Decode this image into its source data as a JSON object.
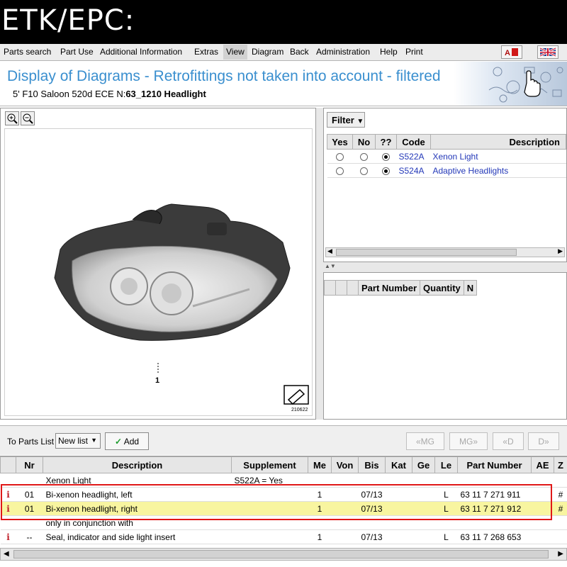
{
  "banner": {
    "text": "ETK/EPC:"
  },
  "menu": {
    "items": [
      "Parts search",
      "Part Use",
      "Additional Information",
      "Extras",
      "View",
      "Diagram",
      "Back",
      "Administration",
      "Help",
      "Print"
    ],
    "selected_index": 4,
    "flag_icons": [
      "language-icon",
      "uk-flag-icon"
    ]
  },
  "header": {
    "title": "Display of Diagrams - Retrofittings not taken into account - filtered",
    "model": "5' F10 Saloon 520d ECE",
    "n_label": "N:",
    "diagram_code": "63_1210 Headlight"
  },
  "diagram": {
    "callout": "1",
    "image_code": "210622",
    "icons": [
      "zoom-in-icon",
      "zoom-out-icon",
      "diagram-export-icon"
    ]
  },
  "filter": {
    "button_label": "Filter",
    "columns": [
      "Yes",
      "No",
      "??",
      "Code",
      "Description"
    ],
    "rows": [
      {
        "selected": "??",
        "code": "S522A",
        "description": "Xenon Light"
      },
      {
        "selected": "??",
        "code": "S524A",
        "description": "Adaptive Headlights"
      }
    ]
  },
  "parts_panel": {
    "columns": [
      "Part Number",
      "Quantity",
      "N"
    ]
  },
  "parts_list_bar": {
    "label": "To Parts List",
    "select_value": "New list",
    "add_label": "Add",
    "nav": [
      "«MG",
      "MG»",
      "«D",
      "D»"
    ]
  },
  "main_table": {
    "columns": [
      "Nr",
      "Description",
      "Supplement",
      "Me",
      "Von",
      "Bis",
      "Kat",
      "Ge",
      "Le",
      "Part Number",
      "AE",
      "Z"
    ],
    "rows": [
      {
        "info": "",
        "nr": "",
        "description": "Xenon Light",
        "supplement": "S522A = Yes",
        "me": "",
        "bis": "",
        "le": "",
        "part": "",
        "z": "",
        "hl": false
      },
      {
        "info": "i",
        "nr": "01",
        "description": "Bi-xenon headlight, left",
        "supplement": "",
        "me": "1",
        "bis": "07/13",
        "le": "L",
        "part": "63 11 7 271 911",
        "z": "#",
        "hl": false
      },
      {
        "info": "i",
        "nr": "01",
        "description": "Bi-xenon headlight, right",
        "supplement": "",
        "me": "1",
        "bis": "07/13",
        "le": "L",
        "part": "63 11 7 271 912",
        "z": "#",
        "hl": true
      },
      {
        "info": "",
        "nr": "",
        "description": "only in conjunction with",
        "supplement": "",
        "me": "",
        "bis": "",
        "le": "",
        "part": "",
        "z": "",
        "hl": false
      },
      {
        "info": "i",
        "nr": "--",
        "description": "Seal, indicator and side light insert",
        "supplement": "",
        "me": "1",
        "bis": "07/13",
        "le": "L",
        "part": "63 11 7 268 653",
        "z": "",
        "hl": false
      }
    ]
  },
  "colors": {
    "title_blue": "#3a8fcf",
    "link_blue": "#2338b8",
    "highlight": "#f8f5a0",
    "red_box": "#e01818",
    "info_red": "#c0202a"
  }
}
